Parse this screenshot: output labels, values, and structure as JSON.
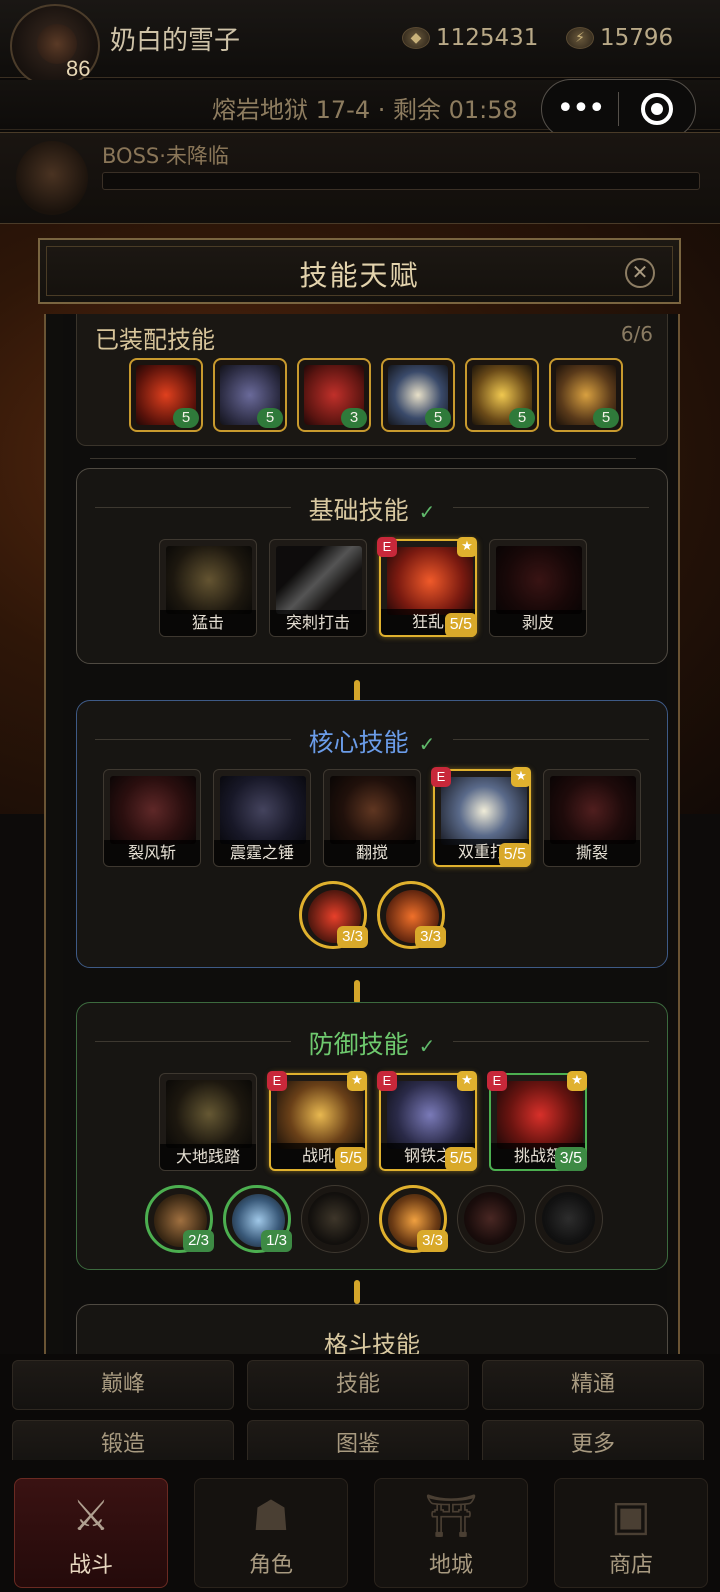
{
  "player": {
    "name": "奶白的雪子",
    "level": "86",
    "gold": "1125431",
    "energy": "15796"
  },
  "stage": {
    "text": "熔岩地狱 17-4 · 剩余 01:58"
  },
  "boss": {
    "label": "BOSS·未降临"
  },
  "modal": {
    "title": "技能天赋",
    "equipped": {
      "title": "已装配技能",
      "count": "6/6",
      "levels": [
        "5",
        "5",
        "3",
        "5",
        "5",
        "5"
      ]
    },
    "sections": {
      "basic": {
        "title": "基础技能",
        "color": "#d8c8a0",
        "skills": [
          "猛击",
          "突刺打击",
          "狂乱",
          "剥皮"
        ],
        "rank": "5/5"
      },
      "core": {
        "title": "核心技能",
        "color": "#6b9ce8",
        "skills": [
          "裂风斩",
          "震霆之锤",
          "翻搅",
          "双重打",
          "撕裂"
        ],
        "rank": "5/5",
        "passives": [
          "3/3",
          "3/3"
        ]
      },
      "defense": {
        "title": "防御技能",
        "color": "#6ec96e",
        "skills": [
          "大地践踏",
          "战吼",
          "钢铁之",
          "挑战怒"
        ],
        "ranks": [
          "5/5",
          "5/5",
          "3/5"
        ],
        "passives": [
          "2/3",
          "1/3",
          "3/3"
        ]
      },
      "next": {
        "title": "格斗技能"
      }
    }
  },
  "badges": {
    "e": "E",
    "star": "★"
  },
  "buttons": [
    "巅峰",
    "技能",
    "精通",
    "锻造",
    "图鉴",
    "更多"
  ],
  "nav": [
    "战斗",
    "角色",
    "地城",
    "商店"
  ],
  "icons": {
    "close": "close-icon",
    "menu": "more-dots-icon",
    "target": "target-icon"
  }
}
